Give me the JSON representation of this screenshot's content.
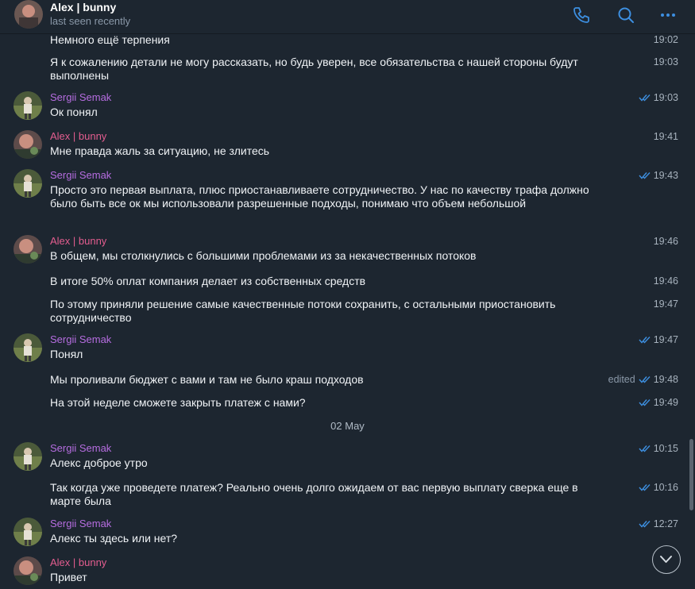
{
  "header": {
    "title": "Alex | bunny",
    "status": "last seen recently",
    "accent": "#3d8fe0"
  },
  "date_separator": "02 May",
  "messages": [
    {
      "sender": "",
      "text": "Немного ещё терпения",
      "time": "19:02"
    },
    {
      "sender": "",
      "text": "Я к сожалению детали не могу рассказать, но будь уверен, все обязательства с нашей стороны будут выполнены",
      "time": "19:03"
    },
    {
      "sender": "Sergii Semak",
      "text": "Ок понял",
      "time": "19:03",
      "read": true
    },
    {
      "sender": "Alex | bunny",
      "text": "Мне правда жаль за ситуацию, не злитесь",
      "time": "19:41"
    },
    {
      "sender": "Sergii Semak",
      "text": "Просто это первая выплата, плюс приостанавливаете сотрудничество. У нас по качеству трафа должно было быть все ок мы использовали разрешенные подходы, понимаю что объем небольшой",
      "time": "19:43",
      "read": true
    },
    {
      "sender": "Alex | bunny",
      "text": "В общем, мы столкнулись с большими проблемами из за некачественных потоков",
      "time": "19:46"
    },
    {
      "sender": "",
      "text": "В итоге 50% оплат компания делает из собственных средств",
      "time": "19:46"
    },
    {
      "sender": "",
      "text": "По этому приняли решение самые качественные потоки сохранить, с остальными приостановить сотрудничество",
      "time": "19:47"
    },
    {
      "sender": "Sergii Semak",
      "text": "Понял",
      "time": "19:47",
      "read": true
    },
    {
      "sender": "",
      "text": "Мы проливали бюджет с вами и там не было краш подходов",
      "time": "19:48",
      "read": true,
      "edited": "edited"
    },
    {
      "sender": "",
      "text": "На этой неделе сможете закрыть платеж с нами?",
      "time": "19:49",
      "read": true
    },
    {
      "sender": "Sergii Semak",
      "text": "Алекс доброе утро",
      "time": "10:15",
      "read": true
    },
    {
      "sender": "",
      "text": "Так когда уже проведете платеж? Реально очень долго ожидаем от вас первую выплату сверка еще в марте была",
      "time": "10:16",
      "read": true
    },
    {
      "sender": "Sergii Semak",
      "text": "Алекс ты здесь или нет?",
      "time": "12:27",
      "read": true
    },
    {
      "sender": "Alex | bunny",
      "text": "Привет",
      "time": ""
    }
  ],
  "colors": {
    "background": "#1d2630",
    "sergii_name": "#b66de0",
    "alex_name": "#e35d8f",
    "check": "#3d8fe0"
  }
}
